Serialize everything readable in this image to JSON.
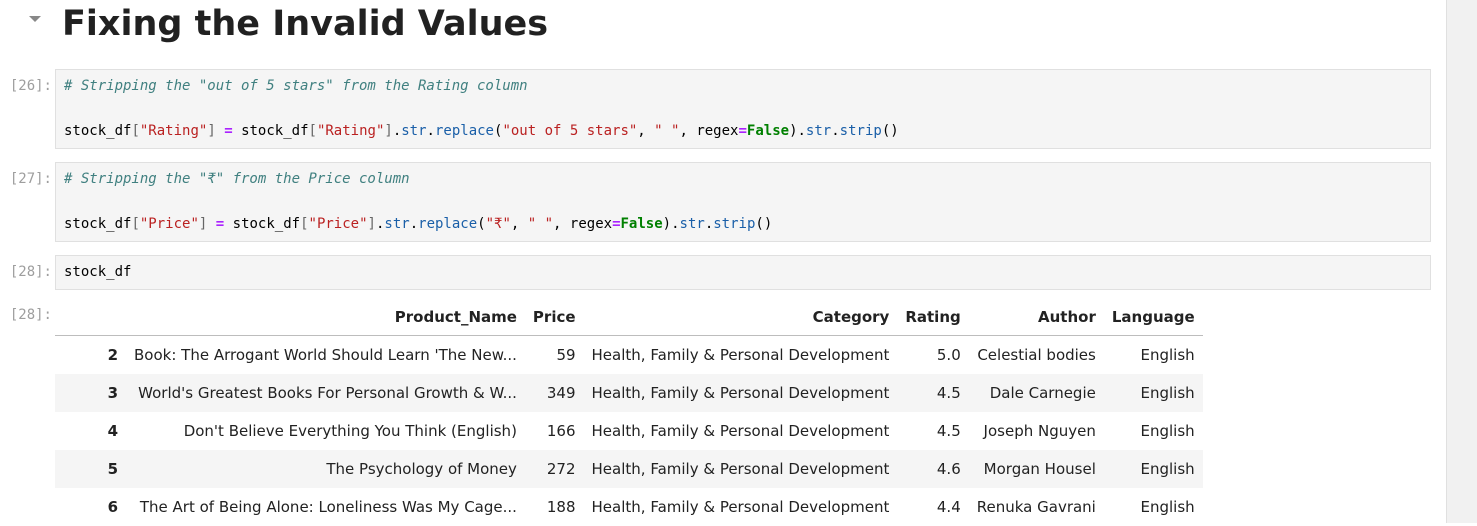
{
  "heading": "Fixing the Invalid Values",
  "cells": [
    {
      "prompt": "[26]:",
      "comment": "# Stripping the \"out of 5 stars\" from the Rating column",
      "code": {
        "var": "stock_df",
        "key": "\"Rating\"",
        "eq": "=",
        "var2": "stock_df",
        "key2": "\"Rating\"",
        "attr1": "str",
        "method1": "replace",
        "arg1": "\"out of 5 stars\"",
        "arg2": "\" \"",
        "kwarg": "regex",
        "kweq": "=",
        "kwval": "False",
        "attr2": "str",
        "method2": "strip"
      }
    },
    {
      "prompt": "[27]:",
      "comment": "# Stripping the \"₹\" from the Price column",
      "code": {
        "var": "stock_df",
        "key": "\"Price\"",
        "eq": "=",
        "var2": "stock_df",
        "key2": "\"Price\"",
        "attr1": "str",
        "method1": "replace",
        "arg1": "\"₹\"",
        "arg2": "\" \"",
        "kwarg": "regex",
        "kweq": "=",
        "kwval": "False",
        "attr2": "str",
        "method2": "strip"
      }
    },
    {
      "prompt": "[28]:",
      "code_text": "stock_df"
    }
  ],
  "output": {
    "prompt": "[28]:",
    "columns": [
      "",
      "Product_Name",
      "Price",
      "Category",
      "Rating",
      "Author",
      "Language"
    ],
    "rows": [
      {
        "index": "2",
        "product_name": "Book: The Arrogant World Should Learn 'The New...",
        "price": "59",
        "category": "Health, Family & Personal Development",
        "rating": "5.0",
        "author": "Celestial bodies",
        "language": "English"
      },
      {
        "index": "3",
        "product_name": "World's Greatest Books For Personal Growth & W...",
        "price": "349",
        "category": "Health, Family & Personal Development",
        "rating": "4.5",
        "author": "Dale Carnegie",
        "language": "English"
      },
      {
        "index": "4",
        "product_name": "Don't Believe Everything You Think (English)",
        "price": "166",
        "category": "Health, Family & Personal Development",
        "rating": "4.5",
        "author": "Joseph Nguyen",
        "language": "English"
      },
      {
        "index": "5",
        "product_name": "The Psychology of Money",
        "price": "272",
        "category": "Health, Family & Personal Development",
        "rating": "4.6",
        "author": "Morgan Housel",
        "language": "English"
      },
      {
        "index": "6",
        "product_name": "The Art of Being Alone: Loneliness Was My Cage...",
        "price": "188",
        "category": "Health, Family & Personal Development",
        "rating": "4.4",
        "author": "Renuka Gavrani",
        "language": "English"
      }
    ]
  }
}
